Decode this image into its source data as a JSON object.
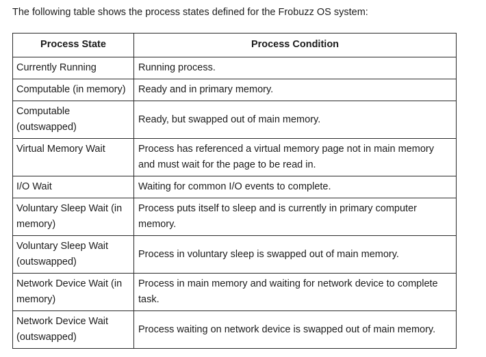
{
  "document": {
    "intro_text": "The following table shows the process states defined for the Frobuzz OS system:",
    "background_color": "#ffffff",
    "text_color": "#1b1b1b",
    "border_color": "#2a2a2a"
  },
  "table": {
    "headers": {
      "col1": "Process State",
      "col2": "Process Condition"
    },
    "rows": [
      {
        "state": "Currently Running",
        "condition": "Running process."
      },
      {
        "state": "Computable (in memory)",
        "condition": "Ready and in primary memory."
      },
      {
        "state": "Computable (outswapped)",
        "condition": "Ready, but swapped out of main memory."
      },
      {
        "state": "Virtual Memory Wait",
        "condition": "Process has referenced a virtual memory page not in main memory and must wait for the page to be read in."
      },
      {
        "state": "I/O Wait",
        "condition": "Waiting for common I/O events to complete."
      },
      {
        "state": "Voluntary Sleep Wait (in memory)",
        "condition": "Process puts itself to sleep and is currently in primary computer memory."
      },
      {
        "state": "Voluntary Sleep Wait (outswapped)",
        "condition": "Process in voluntary sleep is swapped out of main memory."
      },
      {
        "state": "Network Device Wait (in memory)",
        "condition": "Process in main memory and waiting for network device to complete task."
      },
      {
        "state": "Network Device Wait (outswapped)",
        "condition": "Process waiting on network device is swapped out of main memory."
      }
    ]
  }
}
